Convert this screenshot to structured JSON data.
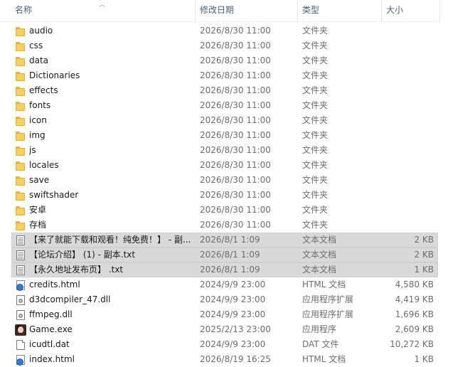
{
  "columns": {
    "name": "名称",
    "date": "修改日期",
    "type": "类型",
    "size": "大小"
  },
  "files": [
    {
      "name": "audio",
      "date": "2026/8/30 11:00",
      "type": "文件夹",
      "size": "",
      "icon": "folder-icon",
      "selected": false
    },
    {
      "name": "css",
      "date": "2026/8/30 11:00",
      "type": "文件夹",
      "size": "",
      "icon": "folder-icon",
      "selected": false
    },
    {
      "name": "data",
      "date": "2026/8/30 11:00",
      "type": "文件夹",
      "size": "",
      "icon": "folder-icon",
      "selected": false
    },
    {
      "name": "Dictionaries",
      "date": "2026/8/30 11:00",
      "type": "文件夹",
      "size": "",
      "icon": "folder-icon",
      "selected": false
    },
    {
      "name": "effects",
      "date": "2026/8/30 11:00",
      "type": "文件夹",
      "size": "",
      "icon": "folder-icon",
      "selected": false
    },
    {
      "name": "fonts",
      "date": "2026/8/30 11:00",
      "type": "文件夹",
      "size": "",
      "icon": "folder-icon",
      "selected": false
    },
    {
      "name": "icon",
      "date": "2026/8/30 11:00",
      "type": "文件夹",
      "size": "",
      "icon": "folder-icon",
      "selected": false
    },
    {
      "name": "img",
      "date": "2026/8/30 11:00",
      "type": "文件夹",
      "size": "",
      "icon": "folder-icon",
      "selected": false
    },
    {
      "name": "js",
      "date": "2026/8/30 11:00",
      "type": "文件夹",
      "size": "",
      "icon": "folder-icon",
      "selected": false
    },
    {
      "name": "locales",
      "date": "2026/8/30 11:00",
      "type": "文件夹",
      "size": "",
      "icon": "folder-icon",
      "selected": false
    },
    {
      "name": "save",
      "date": "2026/8/30 11:00",
      "type": "文件夹",
      "size": "",
      "icon": "folder-icon",
      "selected": false
    },
    {
      "name": "swiftshader",
      "date": "2026/8/30 11:00",
      "type": "文件夹",
      "size": "",
      "icon": "folder-icon",
      "selected": false
    },
    {
      "name": "安卓",
      "date": "2026/8/30 11:00",
      "type": "文件夹",
      "size": "",
      "icon": "folder-icon",
      "selected": false
    },
    {
      "name": "存档",
      "date": "2026/8/30 11:00",
      "type": "文件夹",
      "size": "",
      "icon": "folder-icon",
      "selected": false
    },
    {
      "name": "【来了就能下载和观看！纯免费！】 - 副...",
      "date": "2026/8/1 1:09",
      "type": "文本文档",
      "size": "2 KB",
      "icon": "text-document-icon",
      "selected": true
    },
    {
      "name": "【论坛介绍】 (1) - 副本.txt",
      "date": "2026/8/1 1:09",
      "type": "文本文档",
      "size": "2 KB",
      "icon": "text-document-icon",
      "selected": true
    },
    {
      "name": "【永久地址发布页】 .txt",
      "date": "2026/8/1 1:09",
      "type": "文本文档",
      "size": "1 KB",
      "icon": "text-document-icon",
      "selected": true
    },
    {
      "name": "credits.html",
      "date": "2024/9/9 23:00",
      "type": "HTML 文档",
      "size": "4,580 KB",
      "icon": "html-document-icon",
      "selected": false
    },
    {
      "name": "d3dcompiler_47.dll",
      "date": "2024/9/9 23:00",
      "type": "应用程序扩展",
      "size": "4,419 KB",
      "icon": "dll-file-icon",
      "selected": false
    },
    {
      "name": "ffmpeg.dll",
      "date": "2024/9/9 23:00",
      "type": "应用程序扩展",
      "size": "1,696 KB",
      "icon": "dll-file-icon",
      "selected": false
    },
    {
      "name": "Game.exe",
      "date": "2025/2/13 23:00",
      "type": "应用程序",
      "size": "2,609 KB",
      "icon": "game-exe-icon",
      "selected": false
    },
    {
      "name": "icudtl.dat",
      "date": "2024/9/9 23:00",
      "type": "DAT 文件",
      "size": "10,272 KB",
      "icon": "dat-file-icon",
      "selected": false
    },
    {
      "name": "index.html",
      "date": "2026/8/19 16:25",
      "type": "HTML 文档",
      "size": "1 KB",
      "icon": "html-document-icon",
      "selected": false
    }
  ]
}
